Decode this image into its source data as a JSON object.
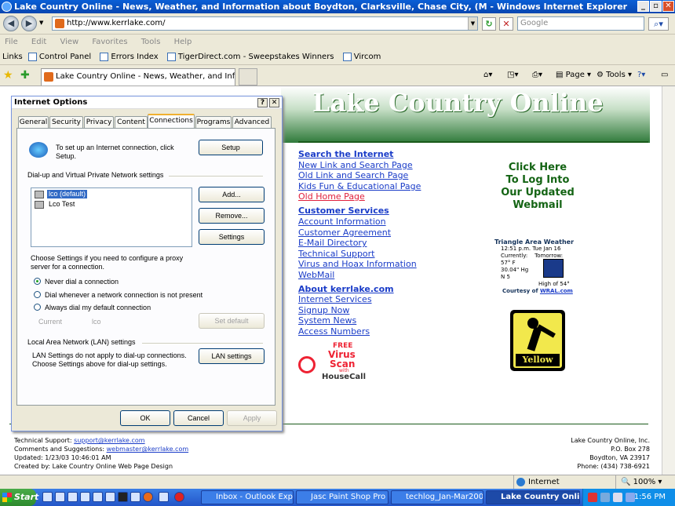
{
  "window": {
    "title": "Lake Country Online - News, Weather, and Information about Boydton, Clarksville, Chase City, (M - Windows Internet Explorer"
  },
  "nav": {
    "address": "http://www.kerrlake.com/",
    "search_placeholder": "Google"
  },
  "menu": [
    "File",
    "Edit",
    "View",
    "Favorites",
    "Tools",
    "Help"
  ],
  "links_bar": {
    "label": "Links",
    "items": [
      "Control Panel",
      "Errors Index",
      "TigerDirect.com - Sweepstakes Winners",
      "Vircom"
    ]
  },
  "tab": {
    "title": "Lake Country Online - News, Weather, and Informati..."
  },
  "toolbar": {
    "page": "Page",
    "tools": "Tools"
  },
  "site": {
    "banner_title": "Lake Country Online",
    "search_heading": "Search the Internet",
    "search_links": [
      "New Link and Search Page",
      "Old Link and Search Page",
      "Kids Fun & Educational Page",
      "Old Home Page"
    ],
    "cs_heading": "Customer Services",
    "cs_links": [
      "Account Information",
      "Customer Agreement",
      "E-Mail Directory",
      "Technical Support",
      "Virus and Hoax Information",
      "WebMail"
    ],
    "about_heading": "About kerrlake.com",
    "about_links": [
      "Internet Services",
      "Signup Now",
      "System News",
      "Access Numbers"
    ],
    "click_here": [
      "Click Here",
      "To Log Into",
      "Our Updated",
      "Webmail"
    ],
    "weather": {
      "title": "Triangle Area Weather",
      "time": "12:51 p.m. Tue Jan 16",
      "currently": "Currently:",
      "tomorrow": "Tomorrow:",
      "temp": "57° F",
      "pressure": "30.04\" Hg",
      "wind": "N 5",
      "high": "High of 54°",
      "courtesy": "Courtesy of",
      "source": "WRAL.com"
    },
    "yellow": "Yellow",
    "virus": {
      "free": "FREE",
      "virus": "Virus",
      "scan": "Scan",
      "with": "with",
      "housecall": "HouseCall"
    },
    "footer_left": {
      "support_label": "Technical Support:",
      "support_email": "support@kerrlake.com",
      "comments_label": "Comments and Suggestions:",
      "comments_email": "webmaster@kerrlake.com",
      "updated": "Updated: 1/23/03 10:46:01 AM",
      "created": "Created by: Lake Country Online Web Page Design"
    },
    "footer_right": [
      "Lake Country Online, Inc.",
      "P.O. Box 278",
      "Boydton, VA 23917",
      "Phone: (434) 738-6921"
    ]
  },
  "status": {
    "zone": "Internet",
    "zoom": "100%"
  },
  "taskbar": {
    "start": "Start",
    "tasks": [
      "Inbox - Outlook Expr...",
      "Jasc Paint Shop Pro -...",
      "techlog_Jan-Mar200...",
      "Lake Country Onli..."
    ],
    "clock": "1:56 PM"
  },
  "dialog": {
    "title": "Internet Options",
    "tabs": [
      "General",
      "Security",
      "Privacy",
      "Content",
      "Connections",
      "Programs",
      "Advanced"
    ],
    "setup_text": "To set up an Internet connection, click Setup.",
    "setup_btn": "Setup",
    "dialup_group": "Dial-up and Virtual Private Network settings",
    "connections": [
      "lco (default)",
      "Lco Test"
    ],
    "add_btn": "Add...",
    "remove_btn": "Remove...",
    "settings_btn": "Settings",
    "proxy_text": "Choose Settings if you need to configure a proxy server for a connection.",
    "radios": [
      "Never dial a connection",
      "Dial whenever a network connection is not present",
      "Always dial my default connection"
    ],
    "current_label": "Current",
    "current_value": "lco",
    "setdefault_btn": "Set default",
    "lan_group": "Local Area Network (LAN) settings",
    "lan_text": "LAN Settings do not apply to dial-up connections. Choose Settings above for dial-up settings.",
    "lan_btn": "LAN settings",
    "ok": "OK",
    "cancel": "Cancel",
    "apply": "Apply"
  }
}
